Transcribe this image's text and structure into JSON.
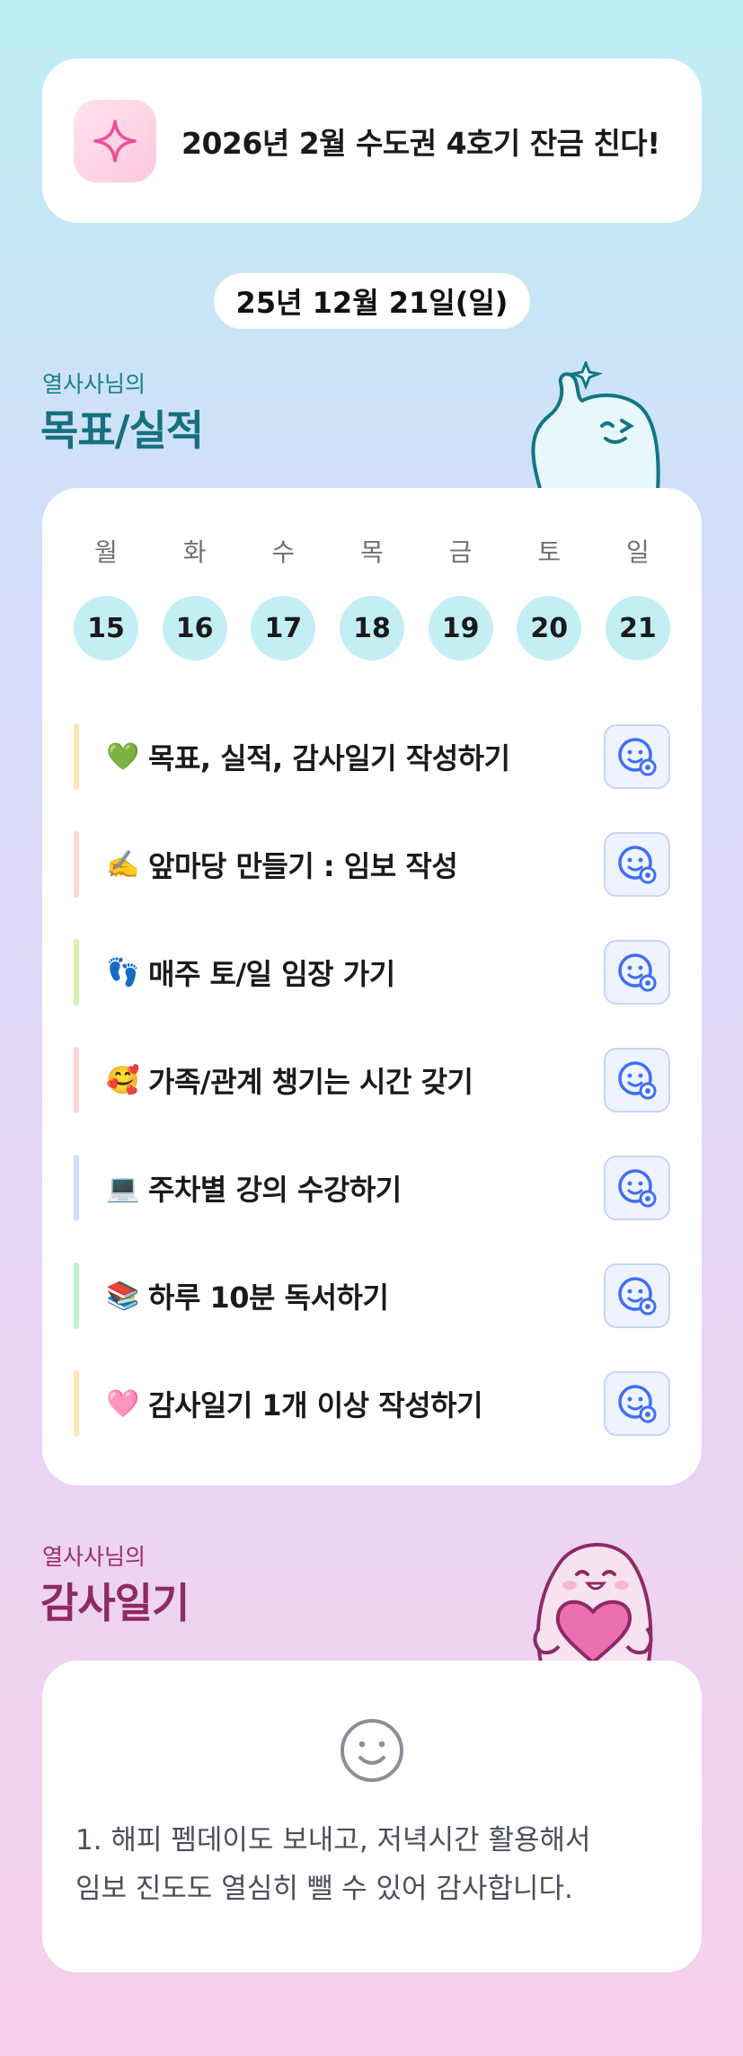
{
  "goal_banner": {
    "icon": "sparkle-icon",
    "text": "2026년 2월 수도권 4호기 잔금 친다!"
  },
  "date": "25년 12월 21일(일)",
  "goals_section": {
    "subtitle": "열사사님의",
    "title": "목표/실적"
  },
  "week": {
    "day_labels": [
      "월",
      "화",
      "수",
      "목",
      "금",
      "토",
      "일"
    ],
    "day_numbers": [
      "15",
      "16",
      "17",
      "18",
      "19",
      "20",
      "21"
    ]
  },
  "goals": [
    {
      "emoji": "💚",
      "text": "목표, 실적, 감사일기 작성하기",
      "bar_color": "#ffe4b8"
    },
    {
      "emoji": "✍️",
      "text": "앞마당 만들기 : 임보 작성",
      "bar_color": "#ffd6d6"
    },
    {
      "emoji": "👣",
      "text": "매주 토/일 임장 가기",
      "bar_color": "#d6f2b0"
    },
    {
      "emoji": "🥰",
      "text": "가족/관계 챙기는 시간 갖기",
      "bar_color": "#ffd0d8"
    },
    {
      "emoji": "💻",
      "text": "주차별 강의 수강하기",
      "bar_color": "#cfe0ff"
    },
    {
      "emoji": "📚",
      "text": "하루 10분 독서하기",
      "bar_color": "#bff0d8"
    },
    {
      "emoji": "🩷",
      "text": "감사일기 1개 이상 작성하기",
      "bar_color": "#ffe4b8"
    }
  ],
  "gratitude_section": {
    "subtitle": "열사사님의",
    "title": "감사일기"
  },
  "gratitude": {
    "icon": "smile-icon",
    "line1": "1. 해피 펨데이도 보내고, 저녁시간 활용해서",
    "line2": "임보 진도도 열심히 뺄 수 있어 감사합니다."
  },
  "colors": {
    "teal_accent": "#17707e",
    "pink_accent": "#8e2a66",
    "check_icon": "#3d6ff5"
  }
}
